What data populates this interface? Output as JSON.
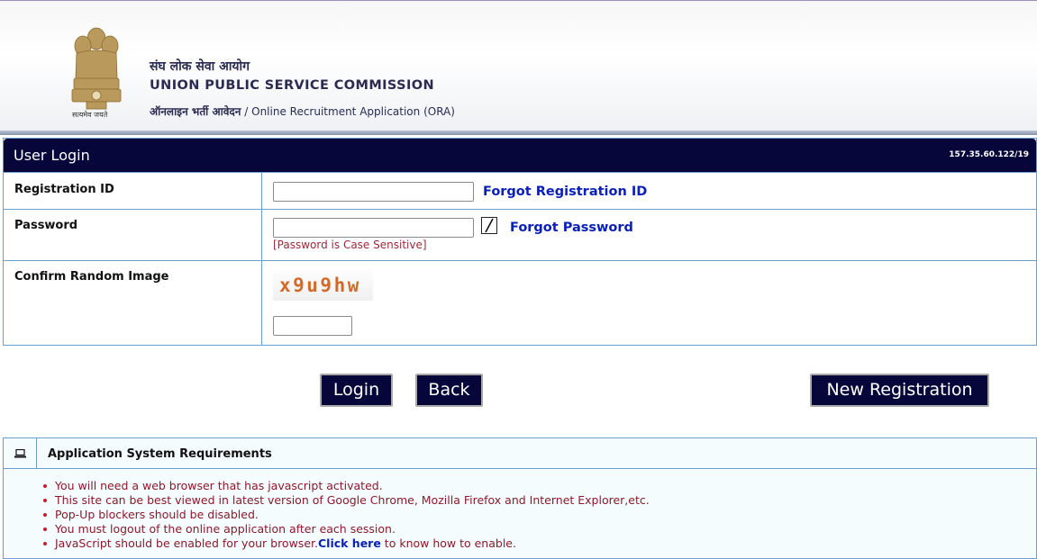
{
  "header": {
    "hindi_title": "संघ लोक सेवा आयोग",
    "english_title": "UNION PUBLIC SERVICE COMMISSION",
    "subtitle_hindi": "ऑनलाइन भर्ती आवेदन",
    "subtitle_sep": " / ",
    "subtitle_english": "Online Recruitment Application (ORA)",
    "emblem_caption": "सत्यमेव जयते"
  },
  "login": {
    "title": "User Login",
    "server_ip": "157.35.60.122/19",
    "registration_id_label": "Registration ID",
    "registration_id_value": "",
    "forgot_registration_id": "Forgot Registration ID",
    "password_label": "Password",
    "password_value": "",
    "forgot_password": "Forgot Password",
    "case_note": "[Password is Case Sensitive]",
    "captcha_label": "Confirm Random Image",
    "captcha_text": "x9u9hw",
    "captcha_value": ""
  },
  "buttons": {
    "login": "Login",
    "back": "Back",
    "new_registration": "New Registration"
  },
  "requirements": {
    "title": "Application System Requirements",
    "items": [
      "You will need a web browser that has javascript activated.",
      "This site can be best viewed in latest version of Google Chrome, Mozilla Firefox and Internet Explorer,etc.",
      "Pop-Up blockers should be disabled.",
      "You must logout of the online application after each session."
    ],
    "last_item_prefix": "JavaScript should be enabled for your browser.",
    "last_item_link": "Click here",
    "last_item_suffix": " to know how to enable."
  },
  "colors": {
    "navy": "#06063a",
    "link_blue": "#0a1fb9",
    "table_border": "#6a9fd0",
    "note_red": "#8c1a2c",
    "captcha_orange": "#d26a2a"
  },
  "icons": [
    "ashoka-emblem",
    "checkbox",
    "laptop-icon"
  ]
}
